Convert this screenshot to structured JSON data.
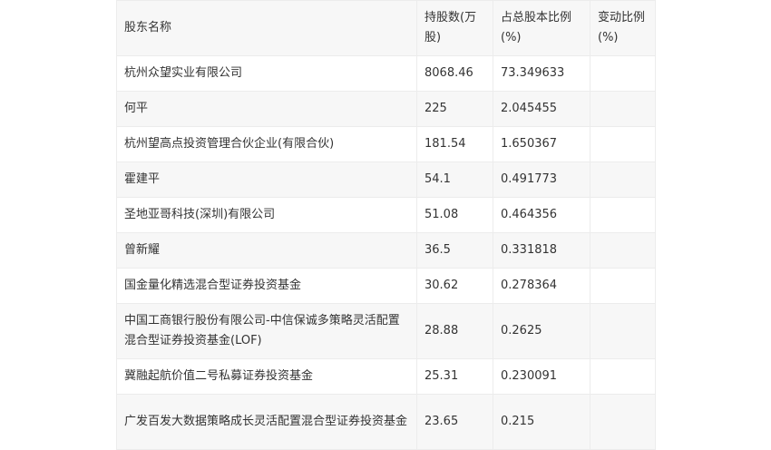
{
  "table": {
    "headers": [
      "股东名称",
      "持股数(万股)",
      "占总股本比例(%)",
      "变动比例(%)"
    ],
    "rows": [
      {
        "name": "杭州众望实业有限公司",
        "shares": "8068.46",
        "ratio": "73.349633",
        "change": ""
      },
      {
        "name": "何平",
        "shares": "225",
        "ratio": "2.045455",
        "change": ""
      },
      {
        "name": "杭州望高点投资管理合伙企业(有限合伙)",
        "shares": "181.54",
        "ratio": "1.650367",
        "change": ""
      },
      {
        "name": "霍建平",
        "shares": "54.1",
        "ratio": "0.491773",
        "change": ""
      },
      {
        "name": "圣地亚哥科技(深圳)有限公司",
        "shares": "51.08",
        "ratio": "0.464356",
        "change": ""
      },
      {
        "name": "曾新耀",
        "shares": "36.5",
        "ratio": "0.331818",
        "change": ""
      },
      {
        "name": "国金量化精选混合型证券投资基金",
        "shares": "30.62",
        "ratio": "0.278364",
        "change": ""
      },
      {
        "name": "中国工商银行股份有限公司-中信保诚多策略灵活配置混合型证券投资基金(LOF)",
        "shares": "28.88",
        "ratio": "0.2625",
        "change": ""
      },
      {
        "name": "冀融起航价值二号私募证券投资基金",
        "shares": "25.31",
        "ratio": "0.230091",
        "change": ""
      },
      {
        "name": "广发百发大数据策略成长灵活配置混合型证券投资基金",
        "shares": "23.65",
        "ratio": "0.215",
        "change": ""
      }
    ]
  }
}
